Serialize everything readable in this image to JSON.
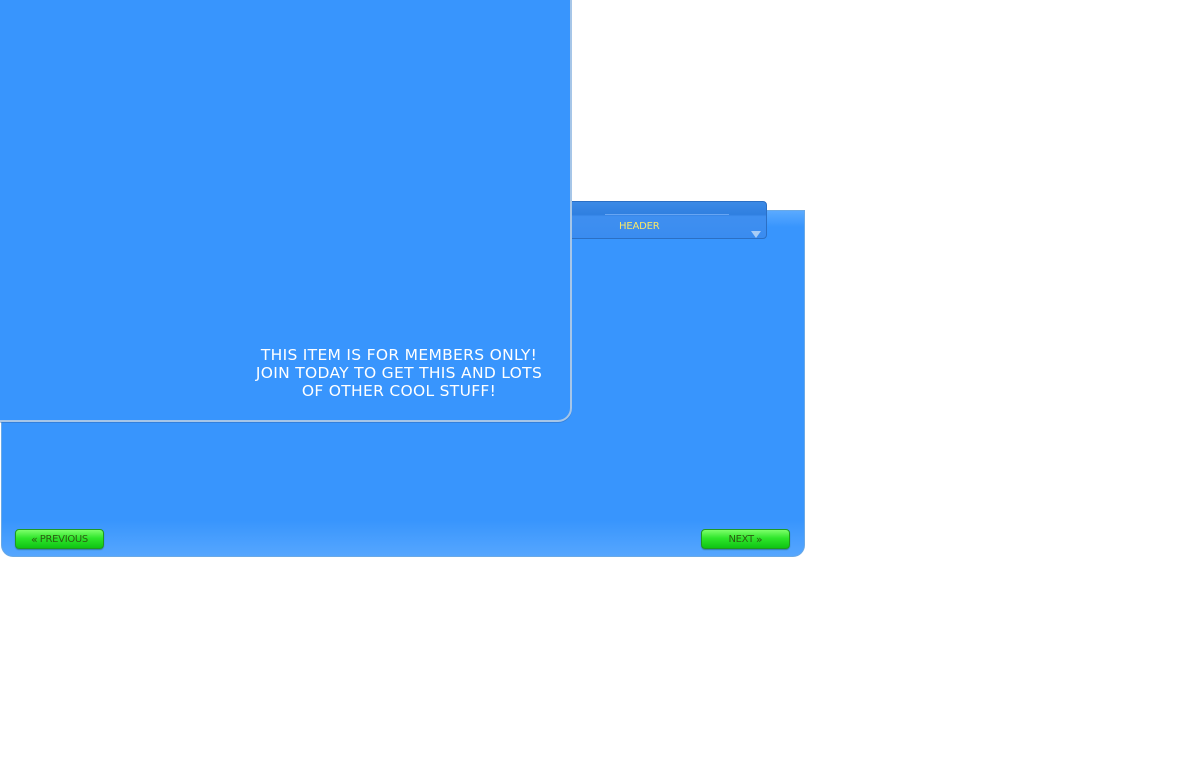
{
  "catalog": {
    "header": {
      "title": "Header",
      "dropdown_icon": "triangle-down-icon"
    },
    "members_notice": {
      "message": "This item is for members only!\nJoin today to get this and lots\nof other cool stuff!"
    },
    "navigation": {
      "previous_label": "Previous",
      "previous_icon": "double-chevron-left-icon",
      "next_label": "Next",
      "next_icon": "double-chevron-right-icon"
    }
  },
  "colors": {
    "panel_blue": "#3895fd",
    "header_blue": "#2f7fe0",
    "header_text": "#f8e86a",
    "button_green": "#2fe62b",
    "button_text": "#2c5c12"
  }
}
